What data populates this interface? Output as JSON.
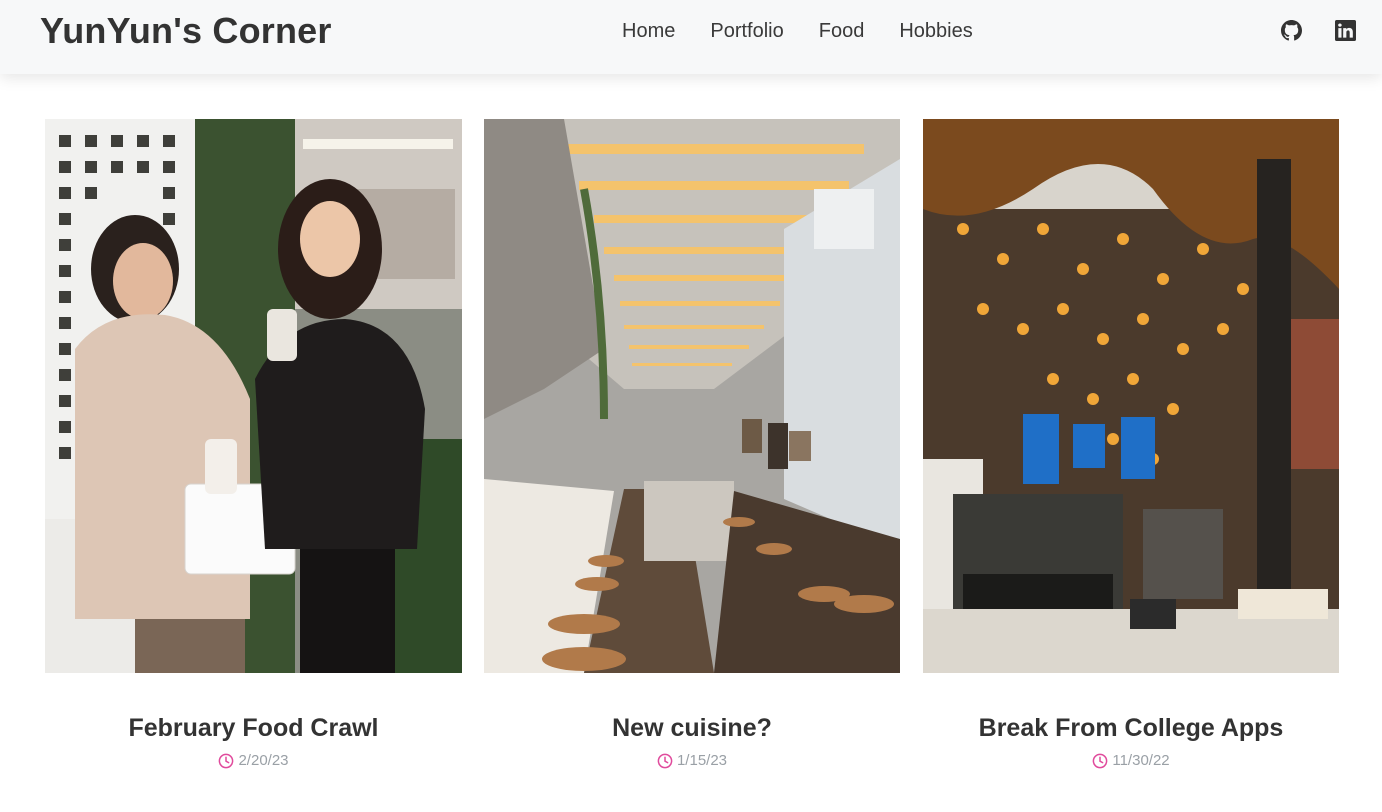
{
  "header": {
    "brand": "YunYun's Corner",
    "nav": [
      {
        "label": "Home"
      },
      {
        "label": "Portfolio"
      },
      {
        "label": "Food"
      },
      {
        "label": "Hobbies"
      }
    ],
    "social": [
      {
        "icon": "github-icon"
      },
      {
        "icon": "linkedin-icon"
      }
    ]
  },
  "posts": [
    {
      "title": "February Food Crawl",
      "date": "2/20/23",
      "image": "photo of two friends laughing with drinks and a pastry box"
    },
    {
      "title": "New cuisine?",
      "date": "1/15/23",
      "image": "photo of a restaurant interior with warm ceiling lights and wooden stools"
    },
    {
      "title": "Break From College Apps",
      "date": "11/30/22",
      "image": "photo of a cafe counter with a ceiling covered in glowing bottles"
    }
  ],
  "colors": {
    "accent": "#e04a9c",
    "nav_bg": "#f7f8f9",
    "muted_text": "#9aa0a6"
  }
}
